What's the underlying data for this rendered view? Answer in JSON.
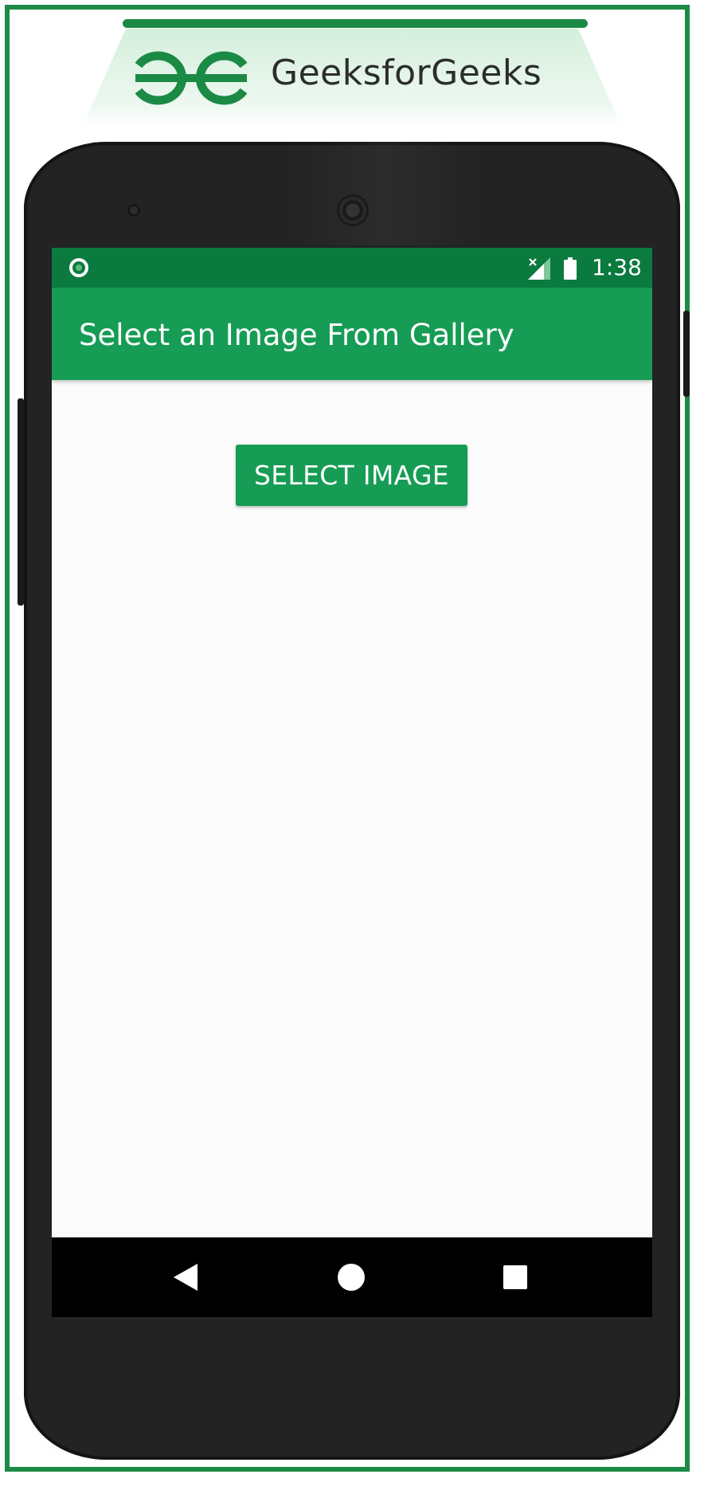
{
  "banner": {
    "brand_name": "GeeksforGeeks",
    "logo_icon": "gfg-logo-icon",
    "brand_color": "#1b8a45"
  },
  "status_bar": {
    "time": "1:38",
    "notification_icon": "circle-notification-icon",
    "signal_icon": "no-signal-icon",
    "battery_icon": "battery-full-icon",
    "color": "#0b7a3f"
  },
  "app_bar": {
    "title": "Select an Image From Gallery",
    "color": "#169c54"
  },
  "main": {
    "select_button_label": "SELECT IMAGE"
  },
  "nav_bar": {
    "back_icon": "back-triangle-icon",
    "home_icon": "home-circle-icon",
    "recents_icon": "recents-square-icon"
  }
}
